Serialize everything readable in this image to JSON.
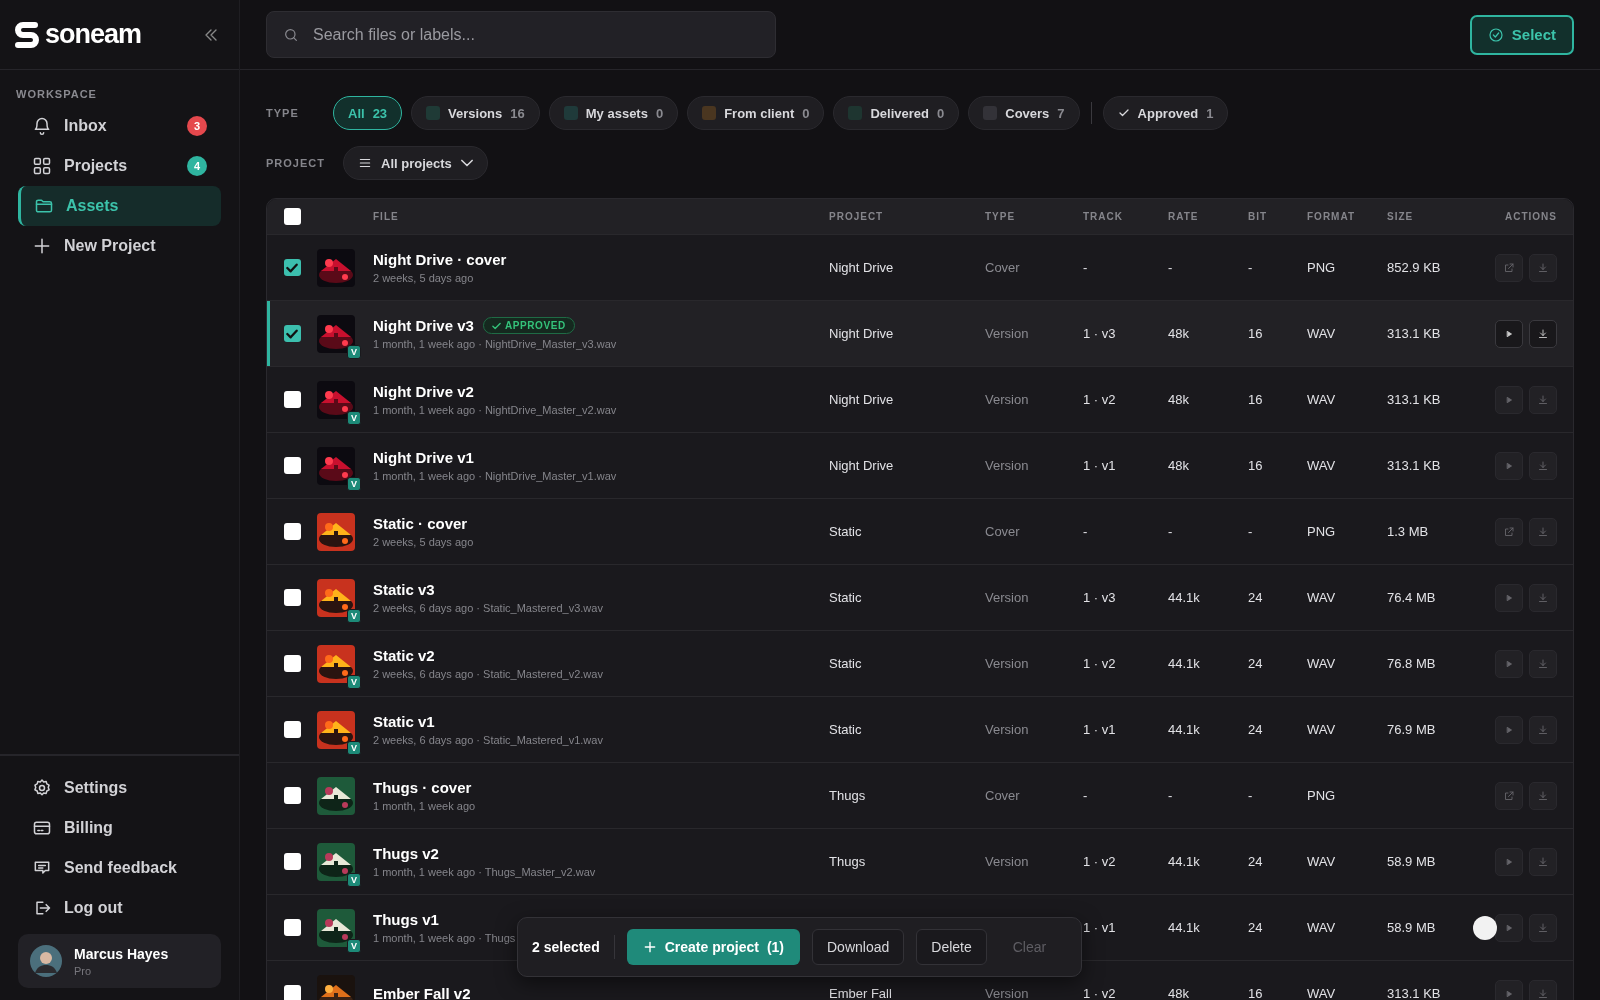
{
  "brand": {
    "name": "soneam"
  },
  "sidebar": {
    "section_label": "WORKSPACE",
    "items": [
      {
        "label": "Inbox",
        "badge": "3",
        "color": "#e5484d",
        "selected": false
      },
      {
        "label": "Projects",
        "badge": "4",
        "color": "#2fb5a0",
        "selected": false
      },
      {
        "label": "Assets",
        "selected": true
      },
      {
        "label": "New Project",
        "selected": false
      }
    ],
    "footer_items": [
      {
        "label": "Settings"
      },
      {
        "label": "Billing"
      },
      {
        "label": "Send feedback"
      },
      {
        "label": "Log out"
      }
    ],
    "user": {
      "name": "Marcus Hayes",
      "plan": "Pro"
    }
  },
  "search": {
    "placeholder": "Search files or labels..."
  },
  "select_button": {
    "label": "Select"
  },
  "filters": {
    "type_label": "TYPE",
    "chips": [
      {
        "kind": "plain",
        "label": "All",
        "count": "23",
        "selected": true
      },
      {
        "kind": "swatch",
        "label": "Versions",
        "count": "16",
        "color": "#1f3a36",
        "selected": false
      },
      {
        "kind": "swatch",
        "label": "My assets",
        "count": "0",
        "color": "#1f3a3a",
        "selected": false
      },
      {
        "kind": "swatch",
        "label": "From client",
        "count": "0",
        "color": "#4a3620",
        "selected": false
      },
      {
        "kind": "swatch",
        "label": "Delivered",
        "count": "0",
        "color": "#1e3530",
        "selected": false
      },
      {
        "kind": "swatch",
        "label": "Covers",
        "count": "7",
        "color": "#333238",
        "selected": false
      },
      {
        "kind": "check",
        "label": "Approved",
        "count": "1",
        "selected": false
      }
    ],
    "project_label": "PROJECT",
    "project_dropdown": "All projects"
  },
  "table": {
    "select_all": false,
    "columns": [
      "FILE",
      "PROJECT",
      "TYPE",
      "TRACK",
      "RATE",
      "BIT",
      "FORMAT",
      "SIZE",
      "ACTIONS"
    ],
    "rows": [
      {
        "kind": "cover",
        "name": "Night Drive · cover",
        "meta": "2 weeks, 5 days ago",
        "selected": true,
        "active": false,
        "project": "Night Drive",
        "type": "Cover",
        "track": "-",
        "rate": "-",
        "bit": "-",
        "format": "PNG",
        "size": "852.9 KB"
      },
      {
        "kind": "version",
        "name": "Night Drive v3",
        "tag": "APPROVED",
        "meta": "1 month, 1 week ago · NightDrive_Master_v3.wav",
        "badge": "V",
        "selected": true,
        "active": true,
        "project": "Night Drive",
        "type": "Version",
        "track": "1 · v3",
        "rate": "48k",
        "bit": "16",
        "format": "WAV",
        "size": "313.1 KB"
      },
      {
        "kind": "version",
        "name": "Night Drive v2",
        "meta": "1 month, 1 week ago · NightDrive_Master_v2.wav",
        "badge": "V",
        "selected": false,
        "active": false,
        "project": "Night Drive",
        "type": "Version",
        "track": "1 · v2",
        "rate": "48k",
        "bit": "16",
        "format": "WAV",
        "size": "313.1 KB"
      },
      {
        "kind": "version",
        "name": "Night Drive v1",
        "meta": "1 month, 1 week ago · NightDrive_Master_v1.wav",
        "badge": "V",
        "selected": false,
        "active": false,
        "project": "Night Drive",
        "type": "Version",
        "track": "1 · v1",
        "rate": "48k",
        "bit": "16",
        "format": "WAV",
        "size": "313.1 KB"
      },
      {
        "kind": "cover",
        "name": "Static · cover",
        "meta": "2 weeks, 5 days ago",
        "selected": false,
        "active": false,
        "project": "Static",
        "type": "Cover",
        "track": "-",
        "rate": "-",
        "bit": "-",
        "format": "PNG",
        "size": "1.3 MB"
      },
      {
        "kind": "version",
        "name": "Static v3",
        "meta": "2 weeks, 6 days ago · Static_Mastered_v3.wav",
        "badge": "V",
        "selected": false,
        "active": false,
        "project": "Static",
        "type": "Version",
        "track": "1 · v3",
        "rate": "44.1k",
        "bit": "24",
        "format": "WAV",
        "size": "76.4 MB"
      },
      {
        "kind": "version",
        "name": "Static v2",
        "meta": "2 weeks, 6 days ago · Static_Mastered_v2.wav",
        "badge": "V",
        "selected": false,
        "active": false,
        "project": "Static",
        "type": "Version",
        "track": "1 · v2",
        "rate": "44.1k",
        "bit": "24",
        "format": "WAV",
        "size": "76.8 MB"
      },
      {
        "kind": "version",
        "name": "Static v1",
        "meta": "2 weeks, 6 days ago · Static_Mastered_v1.wav",
        "badge": "V",
        "selected": false,
        "active": false,
        "project": "Static",
        "type": "Version",
        "track": "1 · v1",
        "rate": "44.1k",
        "bit": "24",
        "format": "WAV",
        "size": "76.9 MB"
      },
      {
        "kind": "cover",
        "name": "Thugs · cover",
        "meta": "1 month, 1 week ago",
        "selected": false,
        "active": false,
        "project": "Thugs",
        "type": "Cover",
        "track": "-",
        "rate": "-",
        "bit": "-",
        "format": "PNG"
      },
      {
        "kind": "version",
        "name": "Thugs v2",
        "meta": "1 month, 1 week ago · Thugs_Master_v2.wav",
        "badge": "V",
        "selected": false,
        "active": false,
        "project": "Thugs",
        "type": "Version",
        "track": "1 · v2",
        "rate": "44.1k",
        "bit": "24",
        "format": "WAV",
        "size": "58.9 MB"
      },
      {
        "kind": "version",
        "name": "Thugs v1",
        "meta": "1 month, 1 week ago · Thugs",
        "badge": "V",
        "selected": false,
        "active": false,
        "pointer": true,
        "track": "1 · v1",
        "rate": "44.1k",
        "bit": "24",
        "format": "WAV",
        "size": "58.9 MB"
      },
      {
        "kind": "version",
        "name": "Ember Fall v2",
        "selected": false,
        "active": false,
        "project": "Ember Fall",
        "type": "Version",
        "track": "1 · v2",
        "rate": "48k",
        "bit": "16",
        "format": "WAV",
        "size": "313.1 KB"
      }
    ]
  },
  "selection_bar": {
    "count": "2 selected",
    "create_label": "Create project",
    "create_count": "(1)",
    "download": "Download",
    "delete": "Delete",
    "clear": "Clear"
  }
}
